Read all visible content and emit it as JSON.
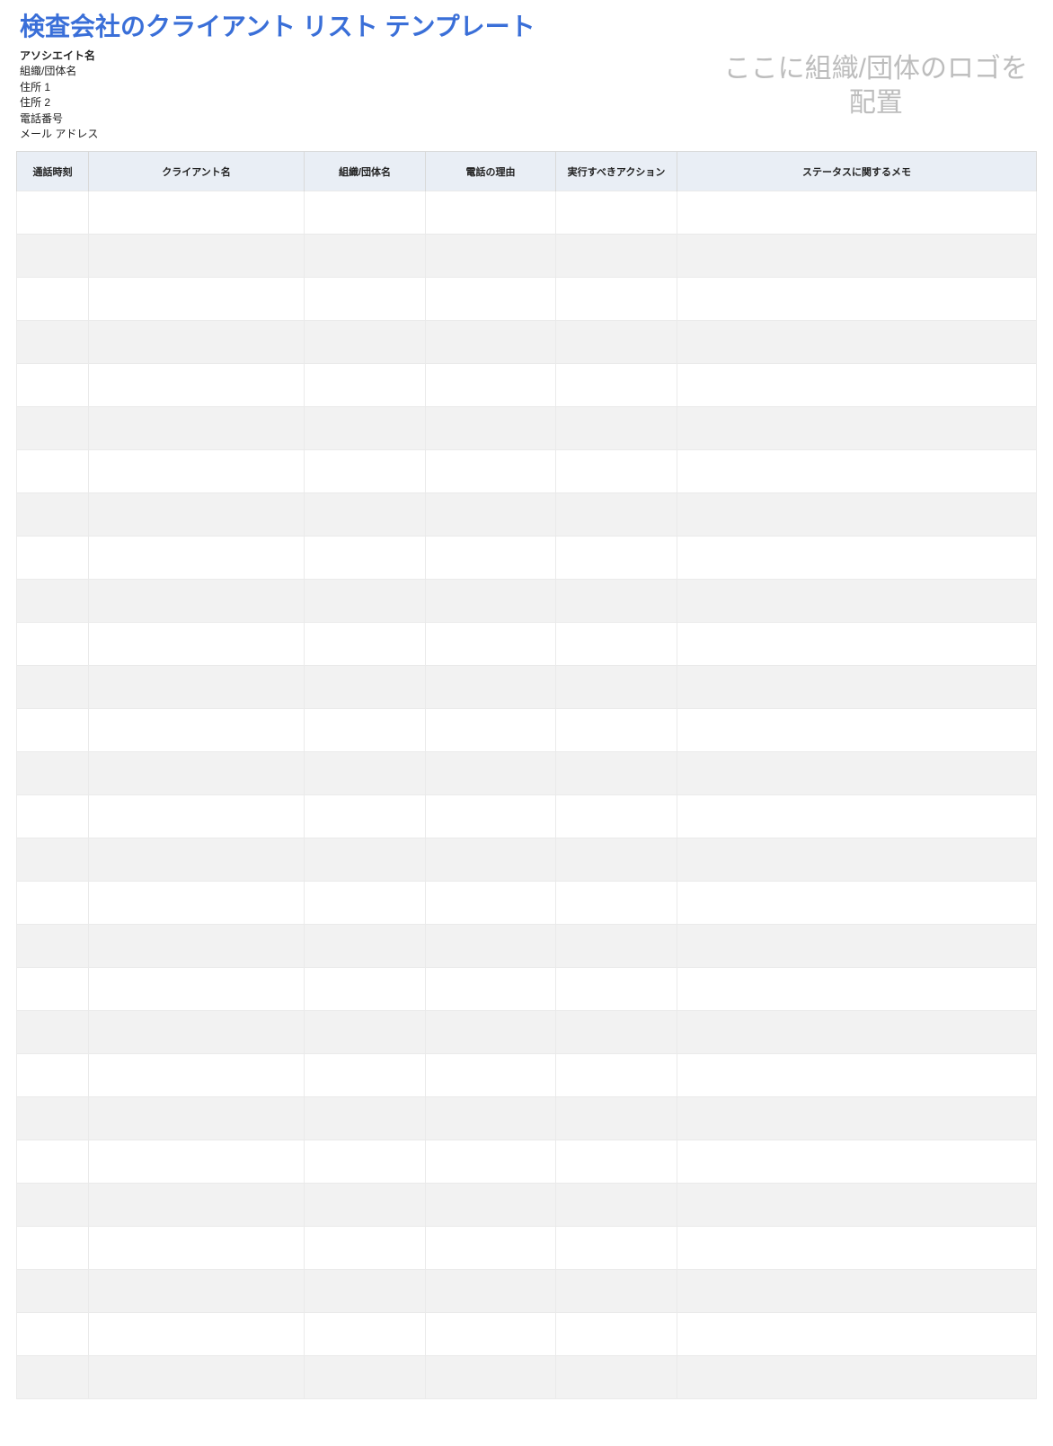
{
  "title": "検査会社のクライアント リスト テンプレート",
  "info": {
    "associate": "アソシエイト名",
    "org": "組織/団体名",
    "addr1": "住所 1",
    "addr2": "住所 2",
    "phone": "電話番号",
    "email": "メール アドレス"
  },
  "logo_placeholder": {
    "line1": "ここに組織/団体のロゴを",
    "line2": "配置"
  },
  "columns": [
    "通話時刻",
    "クライアント名",
    "組織/団体名",
    "電話の理由",
    "実行すべきアクション",
    "ステータスに関するメモ"
  ],
  "rows": [
    [
      "",
      "",
      "",
      "",
      "",
      ""
    ],
    [
      "",
      "",
      "",
      "",
      "",
      ""
    ],
    [
      "",
      "",
      "",
      "",
      "",
      ""
    ],
    [
      "",
      "",
      "",
      "",
      "",
      ""
    ],
    [
      "",
      "",
      "",
      "",
      "",
      ""
    ],
    [
      "",
      "",
      "",
      "",
      "",
      ""
    ],
    [
      "",
      "",
      "",
      "",
      "",
      ""
    ],
    [
      "",
      "",
      "",
      "",
      "",
      ""
    ],
    [
      "",
      "",
      "",
      "",
      "",
      ""
    ],
    [
      "",
      "",
      "",
      "",
      "",
      ""
    ],
    [
      "",
      "",
      "",
      "",
      "",
      ""
    ],
    [
      "",
      "",
      "",
      "",
      "",
      ""
    ],
    [
      "",
      "",
      "",
      "",
      "",
      ""
    ],
    [
      "",
      "",
      "",
      "",
      "",
      ""
    ],
    [
      "",
      "",
      "",
      "",
      "",
      ""
    ],
    [
      "",
      "",
      "",
      "",
      "",
      ""
    ],
    [
      "",
      "",
      "",
      "",
      "",
      ""
    ],
    [
      "",
      "",
      "",
      "",
      "",
      ""
    ],
    [
      "",
      "",
      "",
      "",
      "",
      ""
    ],
    [
      "",
      "",
      "",
      "",
      "",
      ""
    ],
    [
      "",
      "",
      "",
      "",
      "",
      ""
    ],
    [
      "",
      "",
      "",
      "",
      "",
      ""
    ],
    [
      "",
      "",
      "",
      "",
      "",
      ""
    ],
    [
      "",
      "",
      "",
      "",
      "",
      ""
    ],
    [
      "",
      "",
      "",
      "",
      "",
      ""
    ],
    [
      "",
      "",
      "",
      "",
      "",
      ""
    ],
    [
      "",
      "",
      "",
      "",
      "",
      ""
    ],
    [
      "",
      "",
      "",
      "",
      "",
      ""
    ]
  ]
}
